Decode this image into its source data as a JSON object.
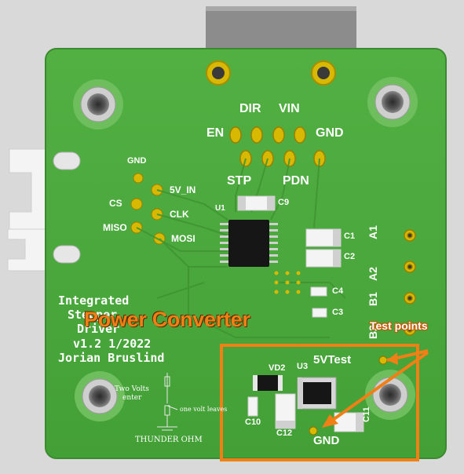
{
  "board": {
    "title_lines": [
      "Integrated",
      "Stepper",
      "Driver",
      "v1.2 1/2022",
      "Jorian Bruslind"
    ],
    "colors": {
      "pcb": "#4aa83a",
      "pcb_edge": "#3d8f2f",
      "silk": "#ffffff",
      "gold": "#d4b400",
      "callout": "#f07f16"
    }
  },
  "callouts": {
    "section_title": "Power Converter",
    "test_points": "Test points"
  },
  "header_pins": {
    "top_labels": [
      "DIR",
      "VIN"
    ],
    "left_label": "EN",
    "right_label": "GND",
    "bottom_labels": [
      "STP",
      "PDN"
    ]
  },
  "uart_pins": {
    "gnd": "GND",
    "cs": "CS",
    "five_v_in": "5V_IN",
    "clk": "CLK",
    "miso": "MISO",
    "mosi": "MOSI"
  },
  "components": {
    "u1": "U1",
    "c9": "C9",
    "c1": "C1",
    "c2": "C2",
    "c3": "C3",
    "c4": "C4",
    "vd2": "VD2",
    "u3": "U3",
    "c10": "C10",
    "c12": "C12",
    "c11": "C11"
  },
  "motor_pins": [
    "A1",
    "A2",
    "B1",
    "B2"
  ],
  "test_point_labels": {
    "five_v": "5VTest",
    "gnd": "GND"
  },
  "handwriting": {
    "line1": "Two Volts",
    "line2": "enter",
    "line3": "one volt leaves",
    "signature": "THUNDER OHM"
  }
}
